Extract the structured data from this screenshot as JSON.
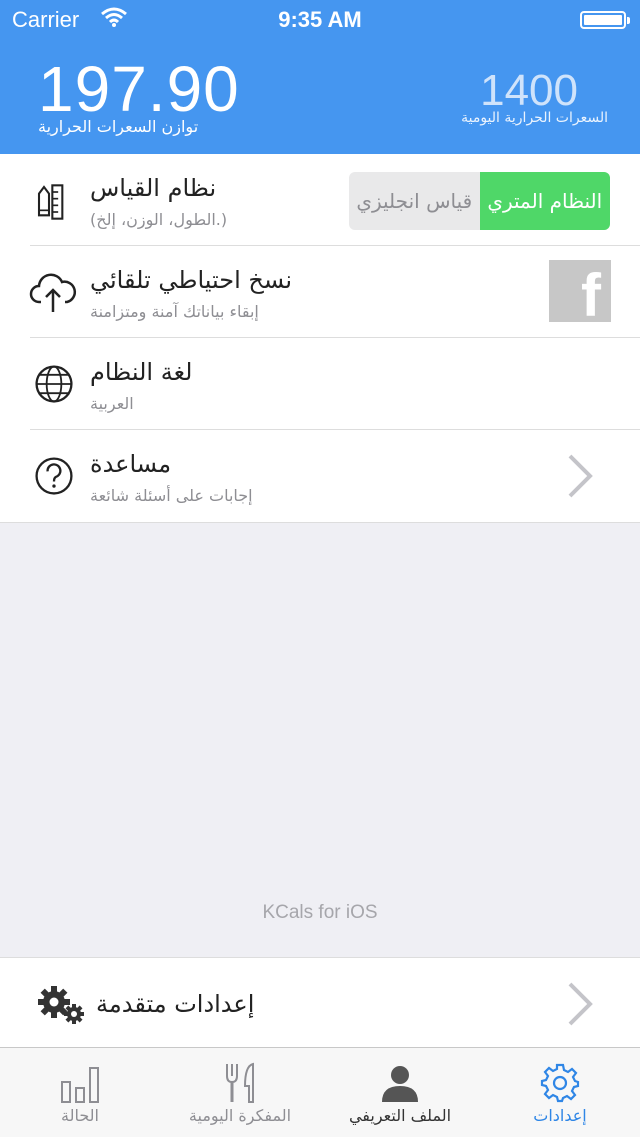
{
  "status_bar": {
    "carrier": "Carrier",
    "time": "9:35 AM"
  },
  "header": {
    "balance_value": "197.90",
    "balance_label": "توازن السعرات الحرارية",
    "daily_value": "1400",
    "daily_label": "السعرات الحرارية اليومية",
    "bg_color": "#4596f0"
  },
  "settings": {
    "measurement": {
      "title": "نظام القياس",
      "subtitle": "(الطول، الوزن، إلخ.)",
      "icon": "pencil-ruler-icon",
      "options": [
        "قياس انجليزي",
        "النظام المتري"
      ],
      "selected": "النظام المتري",
      "accent_color": "#4fd768"
    },
    "backup": {
      "title": "نسخ احتياطي تلقائي",
      "subtitle": "إبقاء بياناتك آمنة ومتزامنة",
      "icon": "cloud-upload-icon",
      "service_icon": "facebook-icon",
      "service_letter": "f"
    },
    "language": {
      "title": "لغة النظام",
      "subtitle": "العربية",
      "icon": "globe-icon"
    },
    "help": {
      "title": "مساعدة",
      "subtitle": "إجابات على أسئلة شائعة",
      "icon": "question-icon"
    }
  },
  "footer_note": "KCals for iOS",
  "advanced": {
    "title": "إعدادات متقدمة",
    "icon": "gears-icon"
  },
  "tabs": [
    {
      "label": "الحالة",
      "icon": "bar-chart-icon",
      "active": false
    },
    {
      "label": "المفكرة اليومية",
      "icon": "fork-knife-icon",
      "active": false
    },
    {
      "label": "الملف التعريفي",
      "icon": "person-icon",
      "active": false
    },
    {
      "label": "إعدادات",
      "icon": "gear-icon",
      "active": true
    }
  ],
  "colors": {
    "active_tab": "#2f86e6"
  }
}
